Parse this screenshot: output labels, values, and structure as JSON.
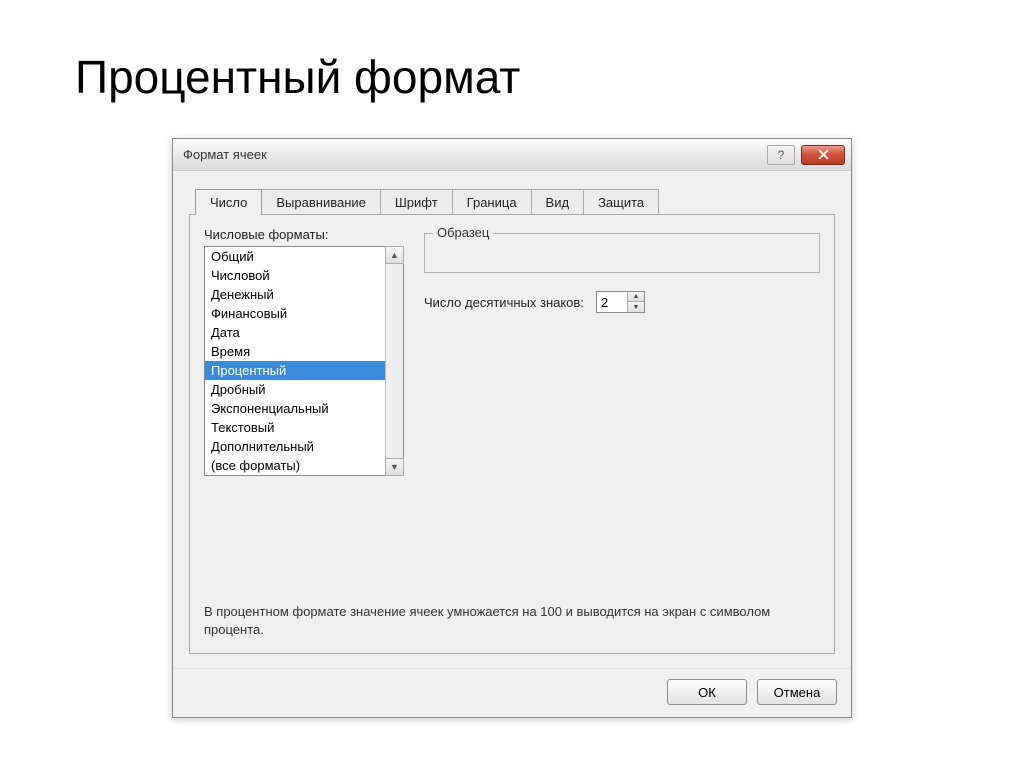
{
  "slide_title": "Процентный формат",
  "dialog": {
    "title": "Формат ячеек",
    "help": "?",
    "close": "X"
  },
  "tabs": [
    {
      "label": "Число",
      "active": true
    },
    {
      "label": "Выравнивание",
      "active": false
    },
    {
      "label": "Шрифт",
      "active": false
    },
    {
      "label": "Граница",
      "active": false
    },
    {
      "label": "Вид",
      "active": false
    },
    {
      "label": "Защита",
      "active": false
    }
  ],
  "formats_label": "Числовые форматы:",
  "formats": [
    {
      "label": "Общий",
      "selected": false
    },
    {
      "label": "Числовой",
      "selected": false
    },
    {
      "label": "Денежный",
      "selected": false
    },
    {
      "label": "Финансовый",
      "selected": false
    },
    {
      "label": "Дата",
      "selected": false
    },
    {
      "label": "Время",
      "selected": false
    },
    {
      "label": "Процентный",
      "selected": true
    },
    {
      "label": "Дробный",
      "selected": false
    },
    {
      "label": "Экспоненциальный",
      "selected": false
    },
    {
      "label": "Текстовый",
      "selected": false
    },
    {
      "label": "Дополнительный",
      "selected": false
    },
    {
      "label": "(все форматы)",
      "selected": false
    }
  ],
  "sample_label": "Образец",
  "decimals_label": "Число десятичных знаков:",
  "decimals_value": "2",
  "description": "В процентном формате значение ячеек умножается на 100 и выводится на экран с символом процента.",
  "buttons": {
    "ok": "ОК",
    "cancel": "Отмена"
  }
}
